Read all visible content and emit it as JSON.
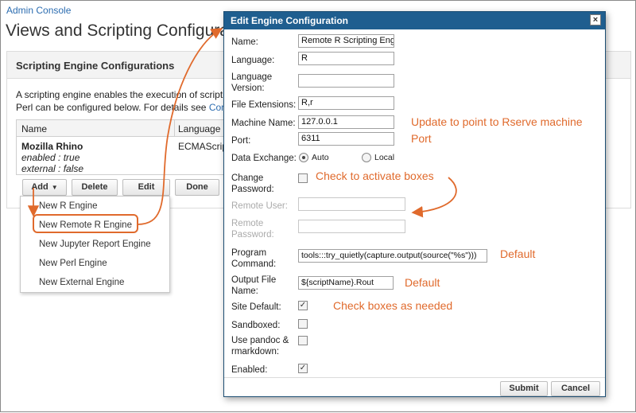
{
  "breadcrumb": "Admin Console",
  "page_title": "Views and Scripting Configuration",
  "panel": {
    "title": "Scripting Engine Configurations",
    "desc_line1": "A scripting engine enables the execution of scripting",
    "desc_line2_prefix": "Perl can be configured below. For details see ",
    "desc_line2_link": "Configu",
    "table": {
      "col_name": "Name",
      "col_language": "Language",
      "row": {
        "name": "Mozilla Rhino",
        "enabled": "enabled : true",
        "external": "external : false",
        "language": "ECMAScript"
      }
    },
    "buttons": {
      "add": "Add",
      "delete": "Delete",
      "edit": "Edit",
      "done": "Done"
    },
    "add_menu": [
      "New R Engine",
      "New Remote R Engine",
      "New Jupyter Report Engine",
      "New Perl Engine",
      "New External Engine"
    ]
  },
  "dialog": {
    "title": "Edit Engine Configuration",
    "close": "×",
    "fields": {
      "name_label": "Name:",
      "name_value": "Remote R Scripting Engine",
      "language_label": "Language:",
      "language_value": "R",
      "language_version_label_1": "Language",
      "language_version_label_2": "Version:",
      "language_version_value": "",
      "file_ext_label": "File Extensions:",
      "file_ext_value": "R,r",
      "machine_label": "Machine Name:",
      "machine_value": "127.0.0.1",
      "port_label": "Port:",
      "port_value": "6311",
      "data_exchange_label": "Data Exchange:",
      "auto_label": "Auto",
      "local_label": "Local",
      "change_pw_label_1": "Change",
      "change_pw_label_2": "Password:",
      "remote_user_label": "Remote User:",
      "remote_user_value": "",
      "remote_pw_label_1": "Remote",
      "remote_pw_label_2": "Password:",
      "remote_pw_value": "",
      "program_cmd_label_1": "Program",
      "program_cmd_label_2": "Command:",
      "program_cmd_value": "tools:::try_quietly(capture.output(source(\"%s\")))",
      "output_file_label_1": "Output File",
      "output_file_label_2": "Name:",
      "output_file_value": "${scriptName}.Rout",
      "site_default_label": "Site Default:",
      "sandboxed_label": "Sandboxed:",
      "pandoc_label_1": "Use pandoc &",
      "pandoc_label_2": "rmarkdown:",
      "enabled_label": "Enabled:"
    },
    "checkboxes": {
      "change_password": false,
      "site_default": true,
      "sandboxed": false,
      "pandoc": false,
      "enabled": true
    },
    "data_exchange_selected": "Auto",
    "buttons": {
      "submit": "Submit",
      "cancel": "Cancel"
    }
  },
  "annotations": {
    "machine": "Update to point to Rserve machine",
    "port": "Port",
    "change_pw": "Check to activate boxes",
    "program": "Default",
    "output": "Default",
    "checkboxes": "Check boxes as needed"
  },
  "colors": {
    "accent_orange": "#e06a2c",
    "titlebar_blue": "#1f5e8f",
    "link_blue": "#2b6cb0"
  }
}
